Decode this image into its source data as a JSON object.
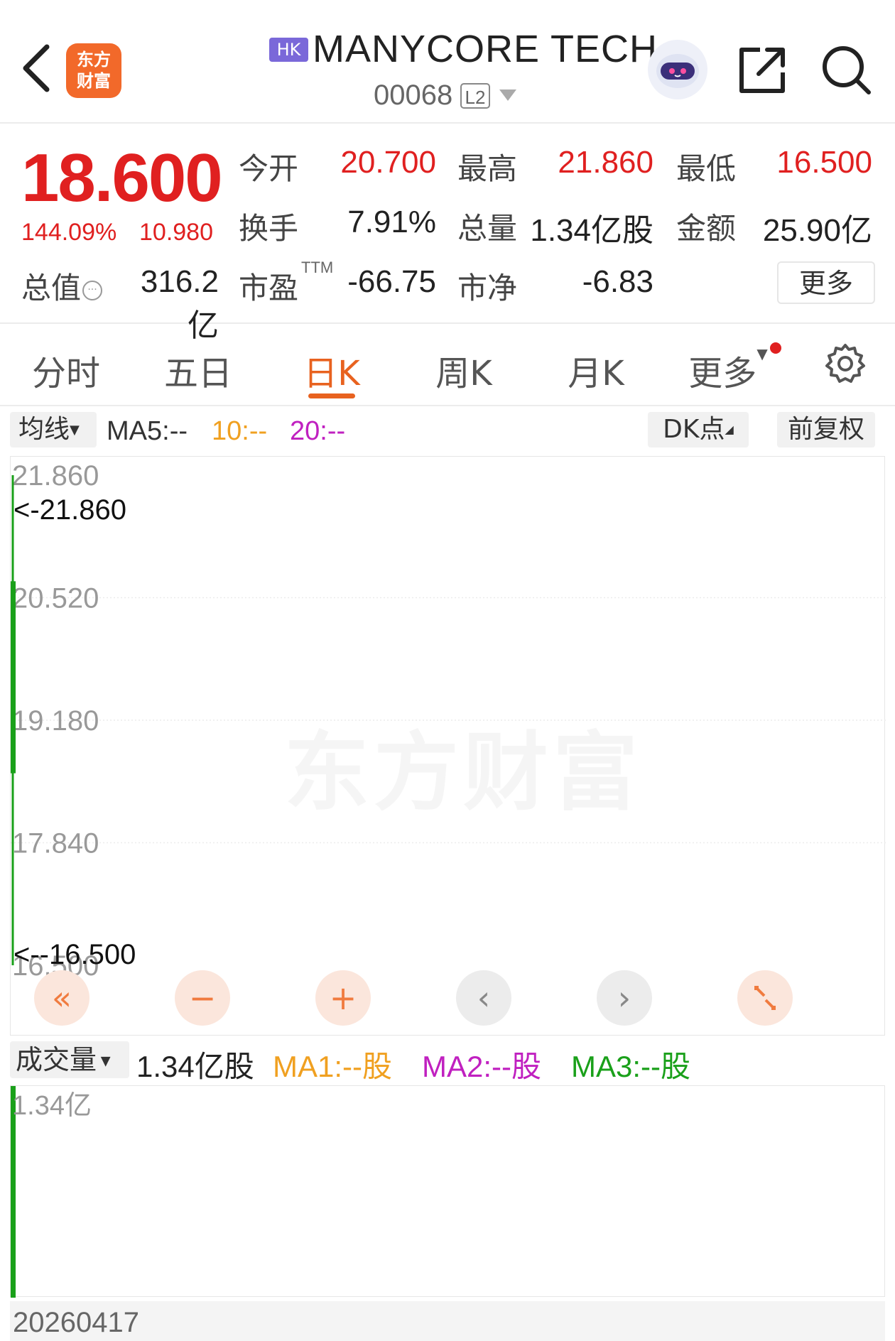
{
  "header": {
    "logo_text": "东方\n财富",
    "market_badge": "HK",
    "stock_name": "MANYCORE TECH",
    "stock_code": "00068",
    "level_badge": "L2"
  },
  "quote": {
    "price": "18.600",
    "change_pct": "144.09%",
    "change_val": "10.980",
    "open_label": "今开",
    "open": "20.700",
    "high_label": "最高",
    "high": "21.860",
    "low_label": "最低",
    "low": "16.500",
    "turnover_label": "换手",
    "turnover": "7.91%",
    "volume_label": "总量",
    "volume": "1.34亿股",
    "amount_label": "金额",
    "amount": "25.90亿",
    "mktcap_label": "总值",
    "mktcap": "316.2亿",
    "pe_label": "市盈",
    "pe_sup": "TTM",
    "pe": "-66.75",
    "pb_label": "市净",
    "pb": "-6.83",
    "more_label": "更多"
  },
  "tabs": [
    {
      "label": "分时"
    },
    {
      "label": "五日"
    },
    {
      "label": "日K",
      "active": true
    },
    {
      "label": "周K"
    },
    {
      "label": "月K"
    },
    {
      "label": "更多"
    }
  ],
  "indicators": {
    "type_label": "均线",
    "ma5": "MA5:--",
    "ma10": "10:--",
    "ma20": "20:--",
    "dk_label": "DK点",
    "adjust_label": "前复权"
  },
  "chart_data": {
    "type": "candlestick",
    "y_ticks": [
      "21.860",
      "20.520",
      "19.180",
      "17.840",
      "16.500"
    ],
    "ylim": [
      16.5,
      21.86
    ],
    "high_marker": "<-21.860",
    "low_marker": "<--16.500",
    "candles": [
      {
        "date": "20260417",
        "open": 20.7,
        "high": 21.86,
        "low": 16.5,
        "close": 18.6
      }
    ],
    "volume": {
      "label": "成交量",
      "value": "1.34亿股",
      "ma1": "MA1:--股",
      "ma2": "MA2:--股",
      "ma3": "MA3:--股",
      "y_tick": "1.34亿",
      "values": [
        1.34
      ]
    },
    "x_label": "20260417"
  },
  "watermark": "东方财富",
  "colors": {
    "up": "#e02020",
    "down": "#1aa01a",
    "accent": "#e8621f",
    "ma10": "#f0a020",
    "ma20": "#c020c0",
    "ma3": "#1aa01a"
  },
  "controls": [
    "fast-rewind-icon",
    "zoom-out-icon",
    "zoom-in-icon",
    "chevron-left-icon",
    "chevron-right-icon",
    "fullscreen-icon"
  ]
}
